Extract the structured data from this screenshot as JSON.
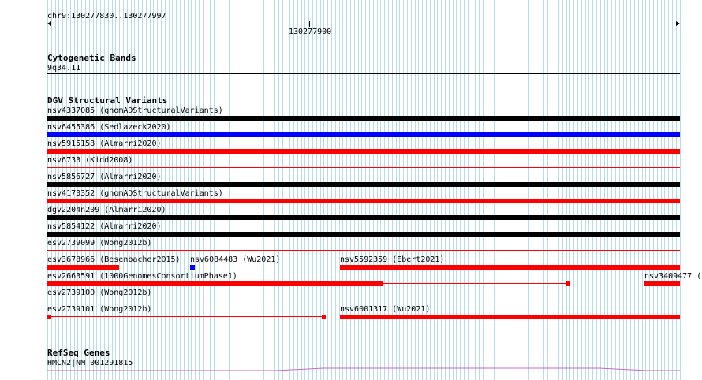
{
  "ruler": {
    "region": "chr9:130277830..130277997",
    "tick_label": "130277900"
  },
  "cytoband": {
    "title": "Cytogenetic Bands",
    "band": "9q34.11"
  },
  "dgv": {
    "title": "DGV Structural Variants",
    "colors": {
      "black": "#000000",
      "blue": "#0000ff",
      "red": "#ff0000"
    },
    "features": [
      {
        "label": "nsv4337085 (gnomADStructuralVariants)",
        "color": "black"
      },
      {
        "label": "nsv6455386 (Sedlazeck2020)",
        "color": "blue"
      },
      {
        "label": "nsv5915158 (Almarri2020)",
        "color": "red"
      },
      {
        "label": "nsv6733 (Kidd2008)",
        "color": "red"
      },
      {
        "label": "nsv5856727 (Almarri2020)",
        "color": "black"
      },
      {
        "label": "nsv4173352 (gnomADStructuralVariants)",
        "color": "red"
      },
      {
        "label": "dgv2204n209 (Almarri2020)",
        "color": "black"
      },
      {
        "label": "nsv5854122 (Almarri2020)",
        "color": "black"
      },
      {
        "label": "esv2739099 (Wong2012b)",
        "color": "red"
      },
      {
        "label": "esv3678966 (Besenbacher2015)",
        "color": "red"
      },
      {
        "label": "nsv6084483 (Wu2021)",
        "color": "blue"
      },
      {
        "label": "nsv5592359 (Ebert2021)",
        "color": "red"
      },
      {
        "label": "esv2663591 (1000GenomesConsortiumPhase1)",
        "color": "red"
      },
      {
        "label": "nsv3409477 (",
        "color": "red"
      },
      {
        "label": "esv2739100 (Wong2012b)",
        "color": "red"
      },
      {
        "label": "esv2739101 (Wong2012b)",
        "color": "red"
      },
      {
        "label": "nsv6001317 (Wu2021)",
        "color": "red"
      }
    ]
  },
  "refseq": {
    "title": "RefSeq Genes",
    "gene": "HMCN2|NM_001291815",
    "color": "#cc66cc"
  }
}
